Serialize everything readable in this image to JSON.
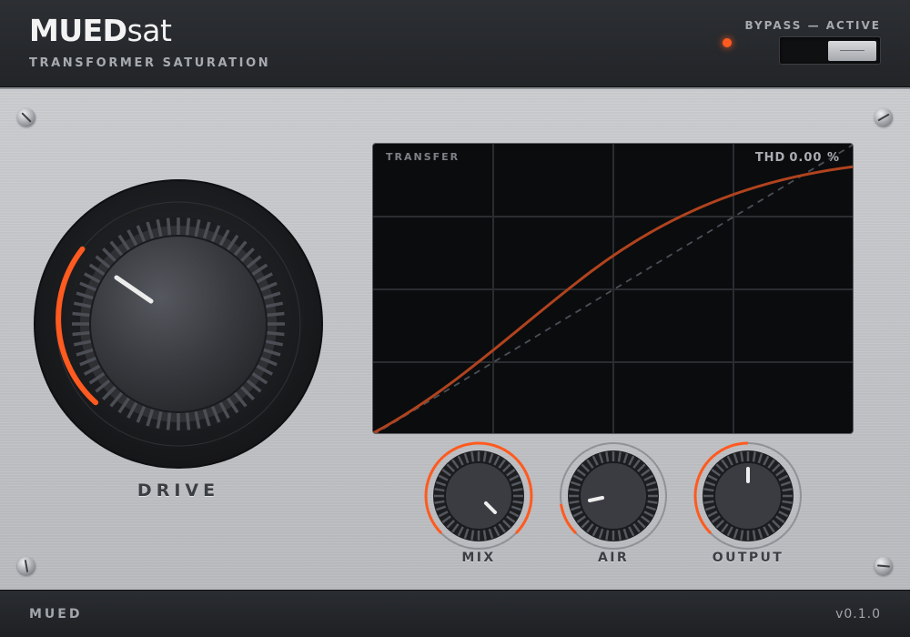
{
  "header": {
    "brand_bold": "MUED",
    "brand_light": "sat",
    "subtitle": "TRANSFORMER SATURATION",
    "bypass_label": "BYPASS — ACTIVE"
  },
  "drive": {
    "label": "DRIVE"
  },
  "screen": {
    "title": "TRANSFER",
    "thd_label": "THD",
    "thd_value": "0.00 %"
  },
  "knobs": {
    "mix": {
      "label": "MIX"
    },
    "air": {
      "label": "AIR"
    },
    "output": {
      "label": "OUTPUT"
    }
  },
  "footer": {
    "brand": "MUED",
    "version": "v0.1.0"
  },
  "colors": {
    "accent": "#ff5a1f",
    "curve": "#b0431e",
    "panel": "#c0c2c6",
    "screen": "#0b0c0e"
  }
}
